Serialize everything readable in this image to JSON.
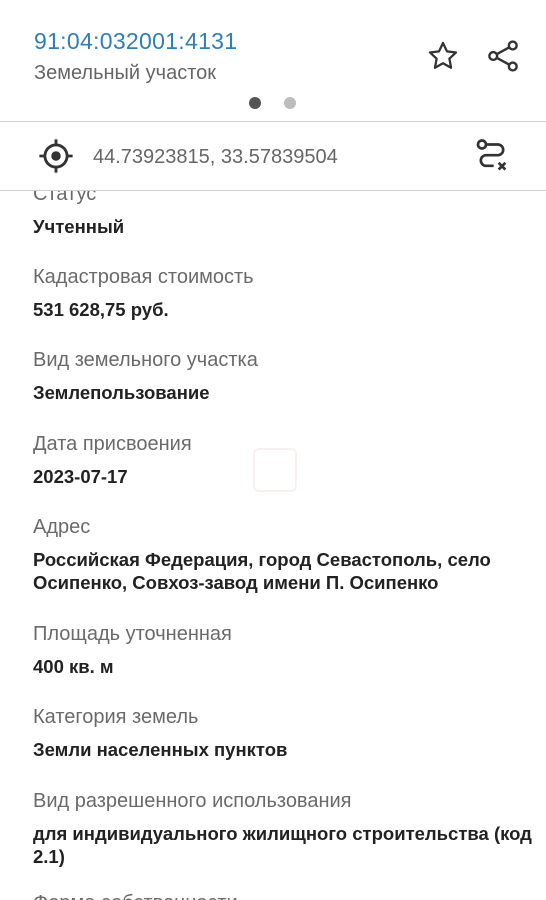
{
  "header": {
    "cadastral_number": "91:04:032001:4131",
    "subtitle": "Земельный участок",
    "star_icon": "star-outline-icon",
    "share_icon": "share-icon"
  },
  "coordinates": {
    "value": "44.73923815, 33.57839504",
    "target_icon": "gps-target-icon",
    "route_icon": "route-clear-icon"
  },
  "fields": [
    {
      "label": "Статус",
      "value": "Учтенный"
    },
    {
      "label": "Кадастровая стоимость",
      "value": "531 628,75 руб."
    },
    {
      "label": "Вид земельного участка",
      "value": "Землепользование"
    },
    {
      "label": "Дата присвоения",
      "value": "2023-07-17"
    },
    {
      "label": "Адрес",
      "value": "Российская Федерация, город Севастополь, село Осипенко, Совхоз-завод имени П. Осипенко"
    },
    {
      "label": "Площадь уточненная",
      "value": "400 кв. м"
    },
    {
      "label": "Категория земель",
      "value": "Земли населенных пунктов"
    },
    {
      "label": "Вид разрешенного использования",
      "value": "для индивидуального жилищного строительства (код 2.1)"
    },
    {
      "label": "Форма собственности",
      "value": ""
    }
  ],
  "colors": {
    "accent": "#2e7fb6",
    "label": "#6a6a6a",
    "value": "#222222",
    "divider": "#cfcfcf"
  }
}
